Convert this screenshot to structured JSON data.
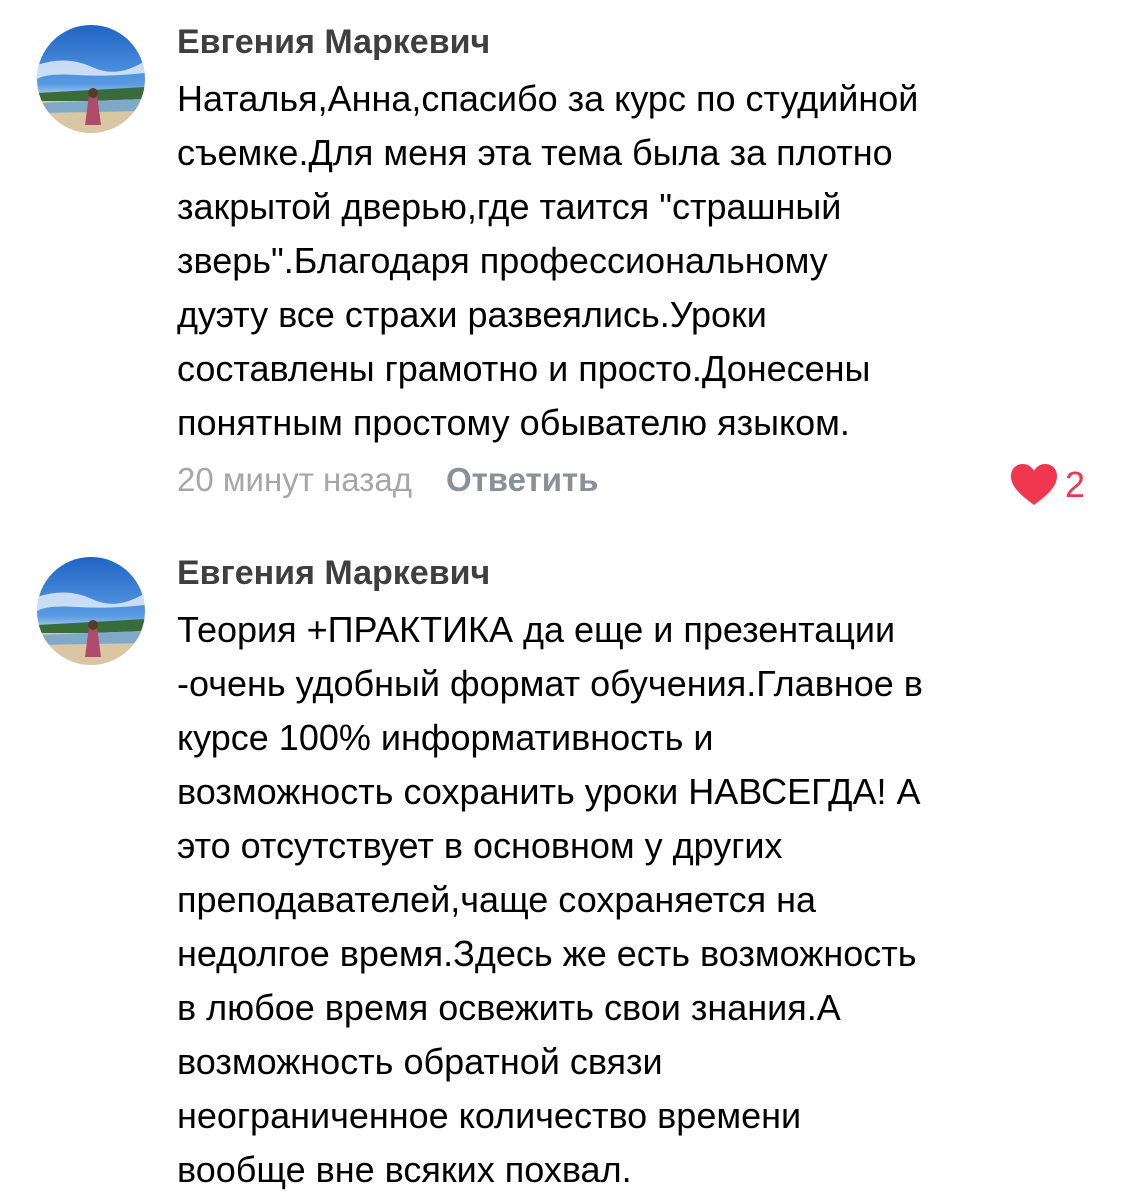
{
  "comments": [
    {
      "author": "Евгения Маркевич",
      "avatar_icon": "avatar-landscape-photo",
      "lines": [
        "Наталья,Анна,спасибо за курс по студийной",
        "съемке.Для меня эта тема была за плотно",
        "закрытой дверью,где таится \"страшный",
        "зверь\".Благодаря профессиональному",
        "дуэту все страхи развеялись.Уроки",
        "составлены грамотно и просто.Донесены",
        "понятным простому обывателю языком."
      ],
      "time": "20 минут назад",
      "reply_label": "Ответить",
      "likes": "2",
      "like_icon": "heart-icon",
      "like_color": "#f0374f"
    },
    {
      "author": "Евгения Маркевич",
      "avatar_icon": "avatar-landscape-photo",
      "lines": [
        "Теория +ПРАКТИКА да еще и презентации",
        "-очень удобный формат обучения.Главное в",
        "курсе 100% информативность и",
        "возможность сохранить уроки НАВСЕГДА! А",
        "это отсутствует в основном у других",
        "преподавателей,чаще сохраняется на",
        "недолгое время.Здесь же есть возможность",
        "в любое время освежить свои знания.А",
        "возможность обратной связи",
        "неограниченное количество времени",
        "вообще вне всяких похвал."
      ]
    }
  ]
}
